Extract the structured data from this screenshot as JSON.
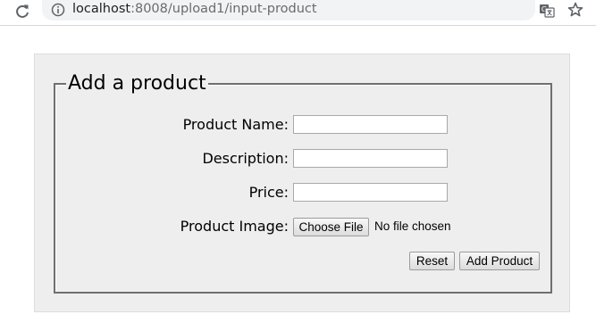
{
  "browser": {
    "url_host": "localhost",
    "url_rest": ":8008/upload1/input-product"
  },
  "form": {
    "legend": "Add a product",
    "fields": [
      {
        "label": "Product Name:",
        "value": "",
        "placeholder": ""
      },
      {
        "label": "Description:",
        "value": "",
        "placeholder": ""
      },
      {
        "label": "Price:",
        "value": "",
        "placeholder": ""
      }
    ],
    "image": {
      "label": "Product Image:",
      "button": "Choose File",
      "status": "No file chosen"
    },
    "reset_label": "Reset",
    "submit_label": "Add Product"
  },
  "icons": {
    "reload": "reload-icon",
    "info": "info-icon",
    "translate": "translate-icon",
    "bookmark": "star-icon"
  }
}
